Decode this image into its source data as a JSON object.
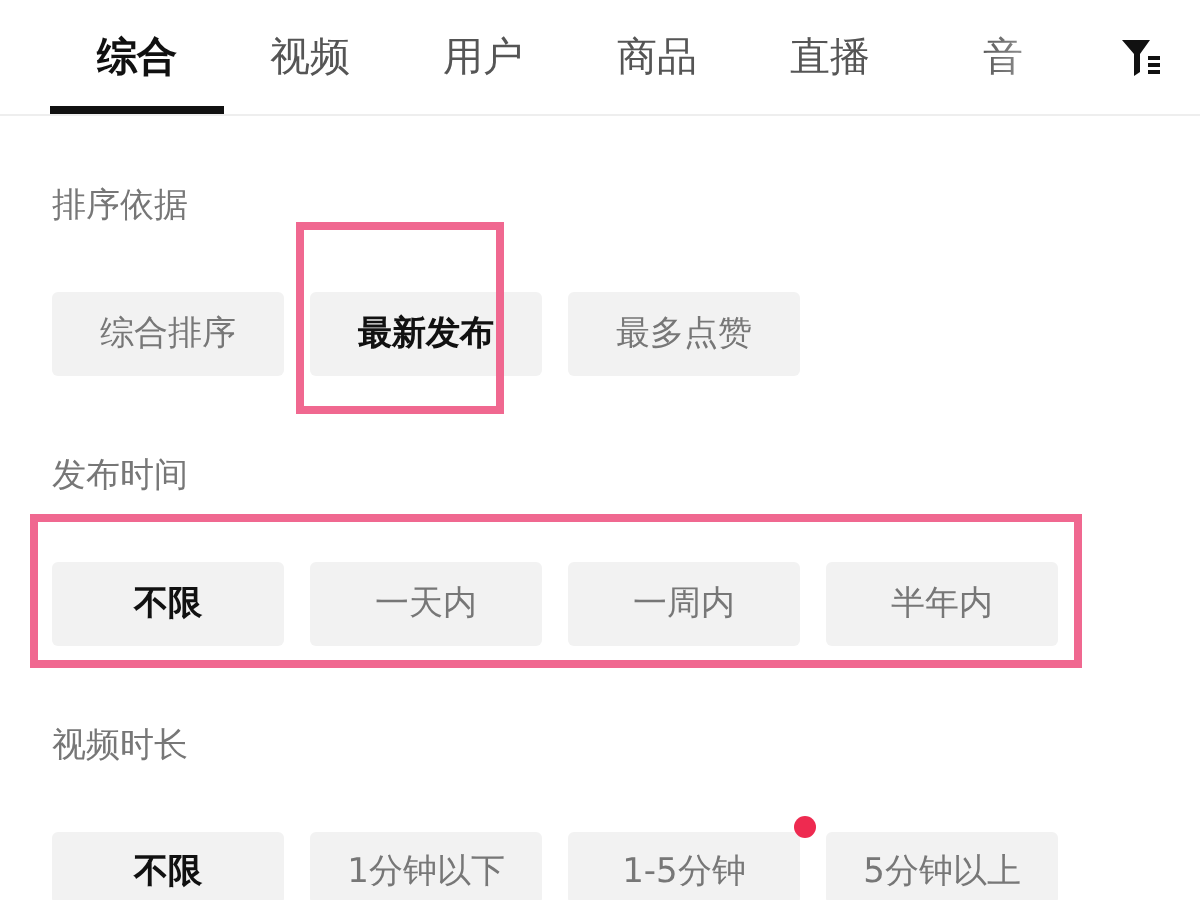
{
  "tabs": [
    {
      "label": "综合",
      "selected": true
    },
    {
      "label": "视频",
      "selected": false
    },
    {
      "label": "用户",
      "selected": false
    },
    {
      "label": "商品",
      "selected": false
    },
    {
      "label": "直播",
      "selected": false
    },
    {
      "label": "音",
      "selected": false
    }
  ],
  "sections": [
    {
      "title": "排序依据",
      "highlighted": false,
      "options": [
        {
          "label": "综合排序",
          "selected": false,
          "highlighted": false,
          "dot": false
        },
        {
          "label": "最新发布",
          "selected": true,
          "highlighted": true,
          "dot": false
        },
        {
          "label": "最多点赞",
          "selected": false,
          "highlighted": false,
          "dot": false
        }
      ]
    },
    {
      "title": "发布时间",
      "highlighted": true,
      "options": [
        {
          "label": "不限",
          "selected": true,
          "highlighted": false,
          "dot": false
        },
        {
          "label": "一天内",
          "selected": false,
          "highlighted": false,
          "dot": false
        },
        {
          "label": "一周内",
          "selected": false,
          "highlighted": false,
          "dot": false
        },
        {
          "label": "半年内",
          "selected": false,
          "highlighted": false,
          "dot": false
        }
      ]
    },
    {
      "title": "视频时长",
      "highlighted": false,
      "options": [
        {
          "label": "不限",
          "selected": true,
          "highlighted": false,
          "dot": false
        },
        {
          "label": "1分钟以下",
          "selected": false,
          "highlighted": false,
          "dot": false
        },
        {
          "label": "1-5分钟",
          "selected": false,
          "highlighted": false,
          "dot": true
        },
        {
          "label": "5分钟以上",
          "selected": false,
          "highlighted": false,
          "dot": false
        }
      ]
    }
  ]
}
